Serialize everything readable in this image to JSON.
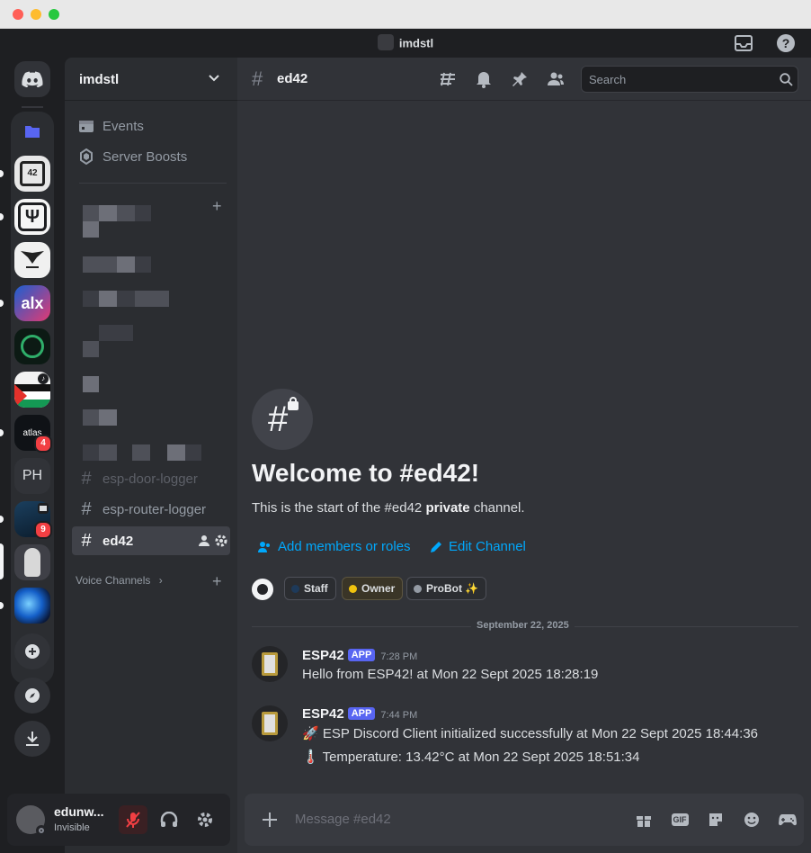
{
  "window": {
    "title": "imdstl"
  },
  "rail": {
    "servers": [
      {
        "name": "ph-server",
        "label": "PH"
      },
      {
        "name": "atlas-server",
        "label": "atlas",
        "badge": "4"
      },
      {
        "name": "night-server",
        "badge": "9"
      }
    ]
  },
  "sidebar": {
    "server_name": "imdstl",
    "events": "Events",
    "server_boosts": "Server Boosts",
    "channels": [
      "esp-door-logger",
      "esp-router-logger",
      "ed42"
    ],
    "voice_category": "Voice Channels"
  },
  "user": {
    "name": "edunw...",
    "status": "Invisible"
  },
  "header": {
    "channel": "ed42",
    "search_placeholder": "Search"
  },
  "welcome": {
    "title": "Welcome to #ed42!",
    "desc_prefix": "This is the start of the #ed42 ",
    "desc_bold": "private",
    "desc_suffix": " channel.",
    "add_members": "Add members or roles",
    "edit_channel": "Edit Channel",
    "tags": [
      {
        "label": "Staff",
        "color": "#1e3a5a"
      },
      {
        "label": "Owner",
        "color": "#f0c30e"
      },
      {
        "label": "ProBot ✨",
        "color": "#949ba4"
      }
    ]
  },
  "date_divider": "September 22, 2025",
  "messages": [
    {
      "author": "ESP42",
      "tag": "APP",
      "time": "7:28 PM",
      "lines": [
        "Hello from ESP42! at Mon 22 Sept 2025 18:28:19"
      ]
    },
    {
      "author": "ESP42",
      "tag": "APP",
      "time": "7:44 PM",
      "lines": [
        "🚀 ESP Discord Client initialized successfully at Mon 22 Sept 2025 18:44:36",
        "🌡️ Temperature: 13.42°C at Mon 22 Sept 2025 18:51:34"
      ]
    }
  ],
  "composer": {
    "placeholder": "Message #ed42",
    "gif_label": "GIF"
  },
  "colors": {
    "accent": "#5865f2",
    "link": "#00a8fc",
    "badge": "#f23f43"
  }
}
